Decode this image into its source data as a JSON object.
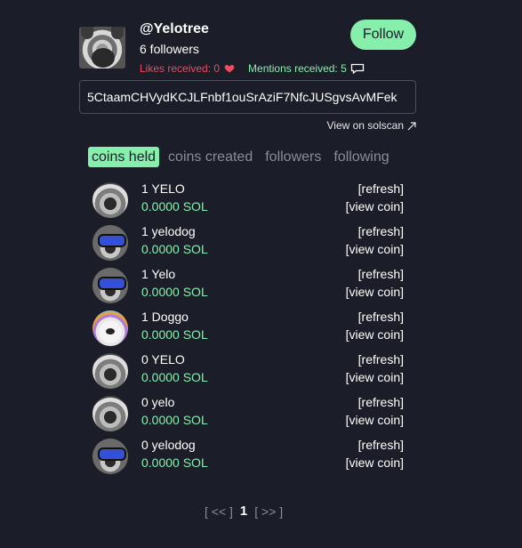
{
  "profile": {
    "username": "@Yelotree",
    "followers": "6 followers",
    "likes": "Likes received: 0",
    "mentions": "Mentions received: 5",
    "follow_label": "Follow",
    "address": "5CtaamCHVydKCJLFnbf1ouSrAziF7NfcJUSgvsAvMFek",
    "solscan_label": "View on solscan"
  },
  "tabs": [
    {
      "label": "coins held",
      "active": true
    },
    {
      "label": "coins created",
      "active": false
    },
    {
      "label": "followers",
      "active": false
    },
    {
      "label": "following",
      "active": false
    }
  ],
  "coins": [
    {
      "name": "1 YELO",
      "sol": "0.0000 SOL",
      "image": "husky-avatar",
      "refresh": "[refresh]",
      "view": "[view coin]"
    },
    {
      "name": "1 yelodog",
      "sol": "0.0000 SOL",
      "image": "husky-goggles-avatar",
      "refresh": "[refresh]",
      "view": "[view coin]"
    },
    {
      "name": "1 Yelo",
      "sol": "0.0000 SOL",
      "image": "husky-goggles-avatar",
      "refresh": "[refresh]",
      "view": "[view coin]"
    },
    {
      "name": "1 Doggo",
      "sol": "0.0000 SOL",
      "image": "samoyed-avatar",
      "refresh": "[refresh]",
      "view": "[view coin]"
    },
    {
      "name": "0 YELO",
      "sol": "0.0000 SOL",
      "image": "husky-avatar",
      "refresh": "[refresh]",
      "view": "[view coin]"
    },
    {
      "name": "0 yelo",
      "sol": "0.0000 SOL",
      "image": "husky-avatar",
      "refresh": "[refresh]",
      "view": "[view coin]"
    },
    {
      "name": "0 yelodog",
      "sol": "0.0000 SOL",
      "image": "husky-goggles-avatar",
      "refresh": "[refresh]",
      "view": "[view coin]"
    }
  ],
  "pagination": {
    "prev": "[ << ]",
    "page": "1",
    "next": "[ >> ]"
  },
  "colors": {
    "background": "#1b1d28",
    "accent": "#86efac",
    "likes": "#f2495c"
  },
  "icons": {
    "heart": "heart-icon",
    "chat": "chat-bubble-icon",
    "external": "external-link-arrow-icon"
  }
}
